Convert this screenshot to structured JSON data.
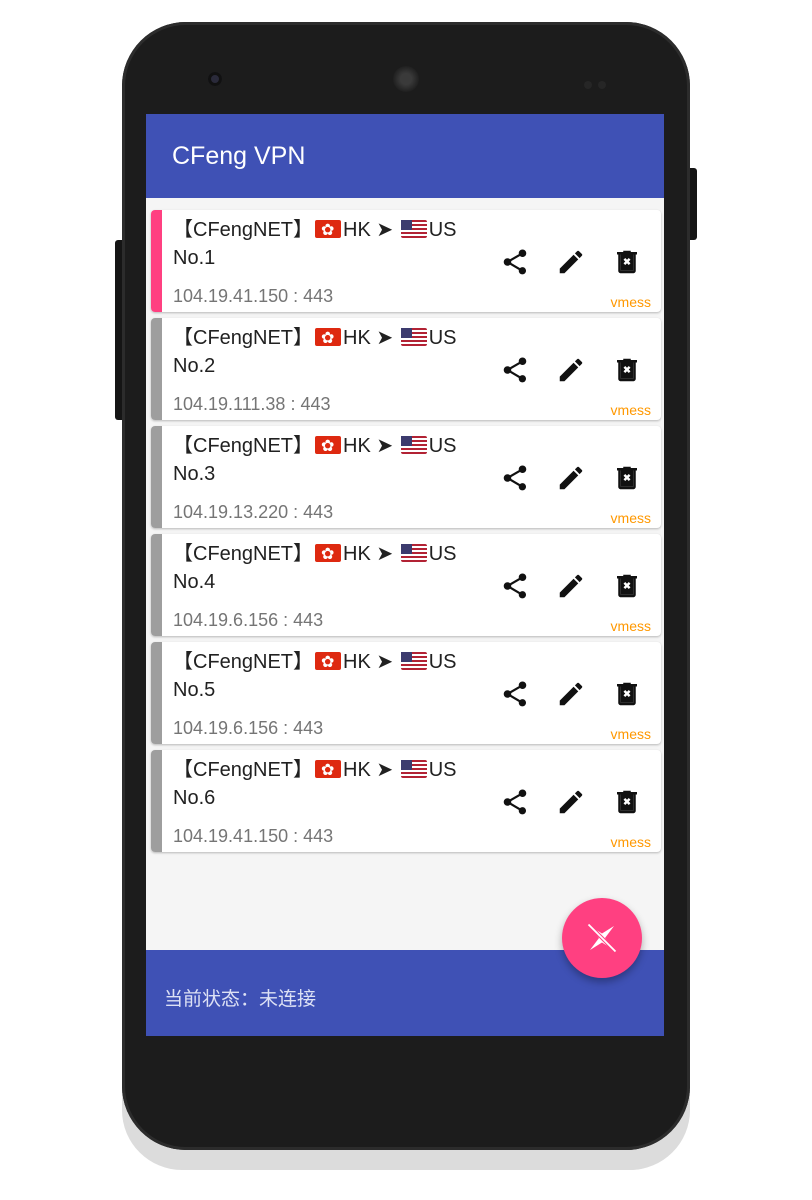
{
  "app": {
    "title": "CFeng VPN"
  },
  "servers": [
    {
      "name": "【CFengNET】",
      "from": "HK",
      "to": "US",
      "number": "No.1",
      "address": "104.19.41.150 : 443",
      "protocol": "vmess",
      "active": true
    },
    {
      "name": "【CFengNET】",
      "from": "HK",
      "to": "US",
      "number": "No.2",
      "address": "104.19.111.38 : 443",
      "protocol": "vmess",
      "active": false
    },
    {
      "name": "【CFengNET】",
      "from": "HK",
      "to": "US",
      "number": "No.3",
      "address": "104.19.13.220 : 443",
      "protocol": "vmess",
      "active": false
    },
    {
      "name": "【CFengNET】",
      "from": "HK",
      "to": "US",
      "number": "No.4",
      "address": "104.19.6.156 : 443",
      "protocol": "vmess",
      "active": false
    },
    {
      "name": "【CFengNET】",
      "from": "HK",
      "to": "US",
      "number": "No.5",
      "address": "104.19.6.156 : 443",
      "protocol": "vmess",
      "active": false
    },
    {
      "name": "【CFengNET】",
      "from": "HK",
      "to": "US",
      "number": "No.6",
      "address": "104.19.41.150 : 443",
      "protocol": "vmess",
      "active": false
    }
  ],
  "icons": {
    "share": "share-icon",
    "edit": "edit-icon",
    "delete": "delete-icon",
    "fab": "disconnected-icon"
  },
  "status": {
    "text": "当前状态：未连接"
  },
  "colors": {
    "primary": "#3f51b5",
    "accent": "#ff4081",
    "protocol": "#ff9800",
    "inactive_stripe": "#9e9e9e"
  }
}
